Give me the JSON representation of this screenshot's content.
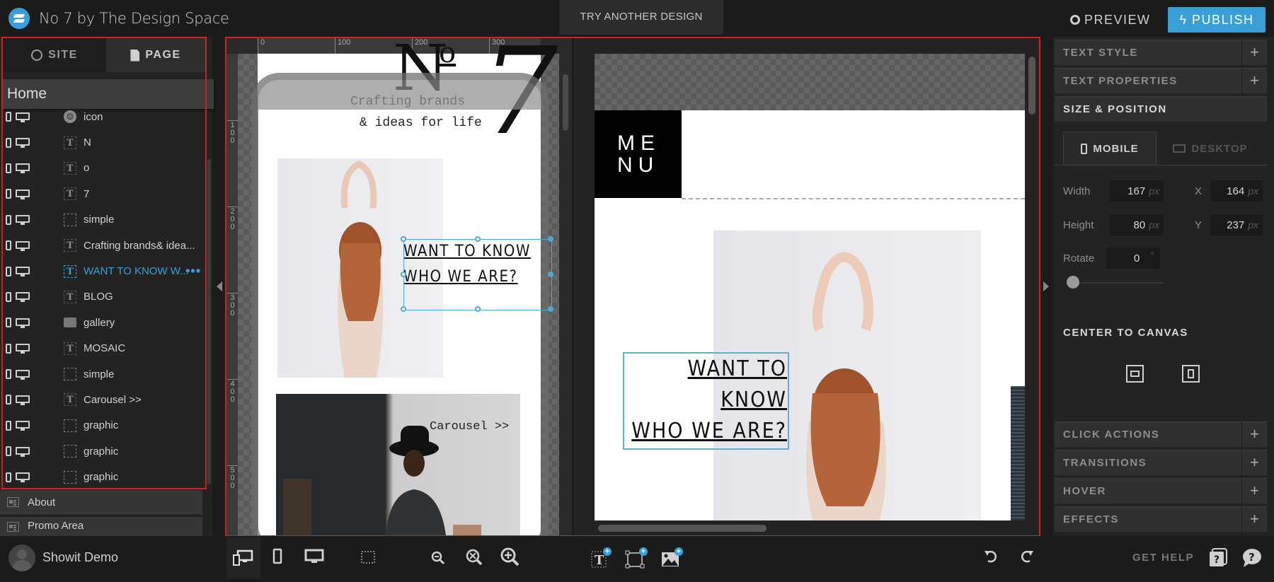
{
  "app": {
    "title": "No 7 by The Design Space",
    "try_another": "TRY ANOTHER DESIGN",
    "preview": "PREVIEW",
    "publish": "PUBLISH",
    "accent_color": "#3a9fd6"
  },
  "left_panel": {
    "tabs": [
      {
        "label": "SITE",
        "icon": "globe-icon",
        "active": false
      },
      {
        "label": "PAGE",
        "icon": "page-icon",
        "active": true
      }
    ],
    "current_page": "Home",
    "layers": [
      {
        "type": "icon",
        "name": "icon"
      },
      {
        "type": "text",
        "name": "N"
      },
      {
        "type": "text",
        "name": "o"
      },
      {
        "type": "text",
        "name": "7"
      },
      {
        "type": "shape",
        "name": "simple"
      },
      {
        "type": "text",
        "name": "Crafting brands& idea..."
      },
      {
        "type": "text",
        "name": "WANT TO KNOW W...",
        "selected": true
      },
      {
        "type": "text",
        "name": "BLOG"
      },
      {
        "type": "image",
        "name": "gallery"
      },
      {
        "type": "text",
        "name": "MOSAIC"
      },
      {
        "type": "shape",
        "name": "simple"
      },
      {
        "type": "text",
        "name": "Carousel >>"
      },
      {
        "type": "shape",
        "name": "graphic"
      },
      {
        "type": "shape",
        "name": "graphic"
      },
      {
        "type": "shape",
        "name": "graphic"
      }
    ],
    "pages": [
      "About",
      "Promo Area"
    ],
    "user": "Showit Demo"
  },
  "canvas": {
    "ruler_h": [
      "0",
      "100",
      "200",
      "300"
    ],
    "ruler_v": [
      "100",
      "200",
      "300",
      "400",
      "500"
    ],
    "mobile": {
      "logo_n": "N",
      "logo_o": "o",
      "logo_7": "7",
      "tagline_1": "Crafting brands",
      "tagline_2": "& ideas for life",
      "headline_1": "WANT TO KNOW",
      "headline_2": "WHO WE ARE?",
      "carousel": "Carousel >>"
    },
    "desktop": {
      "menu_1": "ME",
      "menu_2": "NU",
      "headline_1": "WANT TO KNOW",
      "headline_2": "WHO WE ARE?"
    }
  },
  "right_panel": {
    "sections_top": [
      "TEXT STYLE",
      "TEXT PROPERTIES"
    ],
    "active_section": "SIZE & POSITION",
    "view_tabs": [
      {
        "label": "MOBILE",
        "active": true
      },
      {
        "label": "DESKTOP",
        "active": false
      }
    ],
    "fields": {
      "width": {
        "label": "Width",
        "value": "167",
        "unit": "px"
      },
      "height": {
        "label": "Height",
        "value": "80",
        "unit": "px"
      },
      "x": {
        "label": "X",
        "value": "164",
        "unit": "px"
      },
      "y": {
        "label": "Y",
        "value": "237",
        "unit": "px"
      },
      "rotate": {
        "label": "Rotate",
        "value": "0",
        "unit": "°"
      }
    },
    "rotate_slider_value": 0,
    "center_to_canvas": "CENTER TO CANVAS",
    "sections_bottom": [
      "CLICK ACTIONS",
      "TRANSITIONS",
      "HOVER",
      "EFFECTS"
    ]
  },
  "bottom_toolbar": {
    "get_help": "GET HELP"
  }
}
